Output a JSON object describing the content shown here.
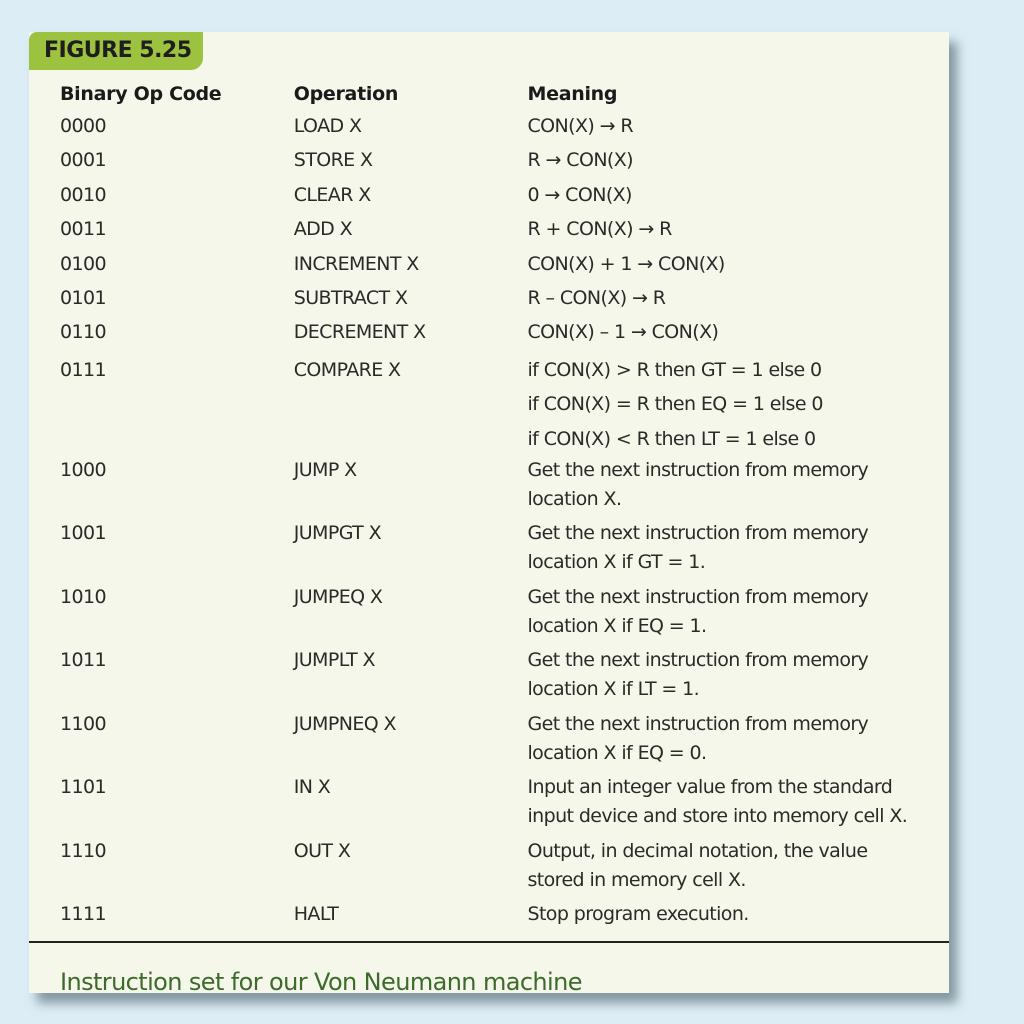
{
  "figure_label": "FIGURE 5.25",
  "table": {
    "headers": [
      "Binary Op Code",
      "Operation",
      "Meaning"
    ],
    "rows": [
      {
        "code": "0000",
        "operation": "LOAD X",
        "meaning": [
          "CON(X) → R"
        ]
      },
      {
        "code": "0001",
        "operation": "STORE X",
        "meaning": [
          "R → CON(X)"
        ]
      },
      {
        "code": "0010",
        "operation": "CLEAR X",
        "meaning": [
          "0 → CON(X)"
        ]
      },
      {
        "code": "0011",
        "operation": "ADD X",
        "meaning": [
          "R + CON(X) → R"
        ]
      },
      {
        "code": "0100",
        "operation": "INCREMENT X",
        "meaning": [
          "CON(X) + 1 → CON(X)"
        ]
      },
      {
        "code": "0101",
        "operation": "SUBTRACT X",
        "meaning": [
          "R – CON(X) → R"
        ]
      },
      {
        "code": "0110",
        "operation": "DECREMENT X",
        "meaning": [
          "CON(X) – 1 → CON(X)"
        ]
      },
      {
        "code": "0111",
        "operation": "COMPARE X",
        "meaning": [
          "if CON(X) > R then GT = 1 else 0",
          "if CON(X) = R then EQ = 1 else 0",
          "if CON(X) < R then LT = 1 else 0"
        ]
      },
      {
        "code": "1000",
        "operation": "JUMP X",
        "meaning": [
          "Get the next instruction from memory",
          "location X."
        ]
      },
      {
        "code": "1001",
        "operation": "JUMPGT X",
        "meaning": [
          "Get the next instruction from memory",
          "location X if GT = 1."
        ]
      },
      {
        "code": "1010",
        "operation": "JUMPEQ X",
        "meaning": [
          "Get the next instruction from memory",
          "location X if EQ = 1."
        ]
      },
      {
        "code": "1011",
        "operation": "JUMPLT X",
        "meaning": [
          "Get the next instruction from memory",
          "location X if LT = 1."
        ]
      },
      {
        "code": "1100",
        "operation": "JUMPNEQ X",
        "meaning": [
          "Get the next instruction from memory",
          "location X if EQ = 0."
        ]
      },
      {
        "code": "1101",
        "operation": "IN X",
        "meaning": [
          "Input an integer value from the standard",
          "input device and store into memory cell X."
        ]
      },
      {
        "code": "1110",
        "operation": "OUT X",
        "meaning": [
          "Output, in decimal notation, the value",
          "stored in memory cell X."
        ]
      },
      {
        "code": "1111",
        "operation": "HALT",
        "meaning": [
          "Stop program execution."
        ]
      }
    ]
  },
  "caption": "Instruction set for our Von Neumann machine",
  "colors": {
    "background": "#dcedf5",
    "card": "#f5f7ea",
    "tab": "#9cc23f",
    "caption": "#3d6b2a"
  }
}
